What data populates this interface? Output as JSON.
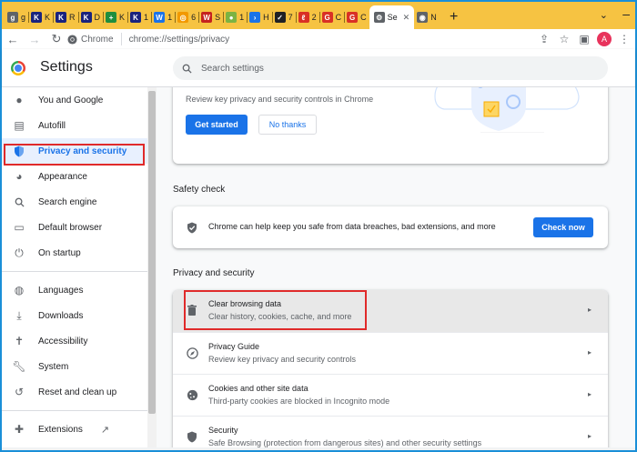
{
  "tabs": [
    {
      "letter": "g",
      "color": "#5f6368",
      "short": "g"
    },
    {
      "letter": "K",
      "color": "#1a237e",
      "short": "K"
    },
    {
      "letter": "K",
      "color": "#1a237e",
      "short": "R"
    },
    {
      "letter": "K",
      "color": "#1a237e",
      "short": "D"
    },
    {
      "letter": "+",
      "color": "#1e8e3e",
      "short": "K"
    },
    {
      "letter": "K",
      "color": "#1a237e",
      "short": "1"
    },
    {
      "letter": "W",
      "color": "#1a73e8",
      "short": "1"
    },
    {
      "letter": "◎",
      "color": "#f29900",
      "short": "6"
    },
    {
      "letter": "W",
      "color": "#c5221f",
      "short": "S"
    },
    {
      "letter": "●",
      "color": "#7cb342",
      "short": "1"
    },
    {
      "letter": "›",
      "color": "#1a73e8",
      "short": "H"
    },
    {
      "letter": "✓",
      "color": "#202124",
      "short": "7"
    },
    {
      "letter": "ℓ",
      "color": "#d93025",
      "short": "2"
    },
    {
      "letter": "G",
      "color": "#d93025",
      "short": "C"
    },
    {
      "letter": "G",
      "color": "#d93025",
      "short": "C"
    },
    {
      "letter": "⚙",
      "color": "#5f6368",
      "short": "Se",
      "active": true
    },
    {
      "letter": "◉",
      "color": "#5f6368",
      "short": "N"
    }
  ],
  "toolbar": {
    "chip_label": "Chrome",
    "url": "chrome://settings/privacy",
    "avatar_letter": "A"
  },
  "header": {
    "title": "Settings",
    "search_placeholder": "Search settings"
  },
  "sidebar": {
    "items": [
      {
        "label": "You and Google",
        "icon": "person-icon"
      },
      {
        "label": "Autofill",
        "icon": "clipboard-icon"
      },
      {
        "label": "Privacy and security",
        "icon": "shield-icon"
      },
      {
        "label": "Appearance",
        "icon": "palette-icon"
      },
      {
        "label": "Search engine",
        "icon": "search-icon"
      },
      {
        "label": "Default browser",
        "icon": "browser-icon"
      },
      {
        "label": "On startup",
        "icon": "power-icon"
      },
      {
        "label": "Languages",
        "icon": "globe-icon"
      },
      {
        "label": "Downloads",
        "icon": "download-icon"
      },
      {
        "label": "Accessibility",
        "icon": "accessibility-icon"
      },
      {
        "label": "System",
        "icon": "wrench-icon"
      },
      {
        "label": "Reset and clean up",
        "icon": "history-icon"
      },
      {
        "label": "Extensions",
        "icon": "puzzle-icon"
      }
    ]
  },
  "guide_card": {
    "text": "Review key privacy and security controls in Chrome",
    "get_started": "Get started",
    "no_thanks": "No thanks"
  },
  "safety_check": {
    "heading": "Safety check",
    "text": "Chrome can help keep you safe from data breaches, bad extensions, and more",
    "button": "Check now"
  },
  "privacy_section": {
    "heading": "Privacy and security",
    "rows": [
      {
        "title": "Clear browsing data",
        "subtitle": "Clear history, cookies, cache, and more"
      },
      {
        "title": "Privacy Guide",
        "subtitle": "Review key privacy and security controls"
      },
      {
        "title": "Cookies and other site data",
        "subtitle": "Third-party cookies are blocked in Incognito mode"
      },
      {
        "title": "Security",
        "subtitle": "Safe Browsing (protection from dangerous sites) and other security settings"
      }
    ]
  },
  "colors": {
    "accent": "#1a73e8",
    "tabstrip": "#f6c342",
    "highlight": "#e02a2a"
  }
}
